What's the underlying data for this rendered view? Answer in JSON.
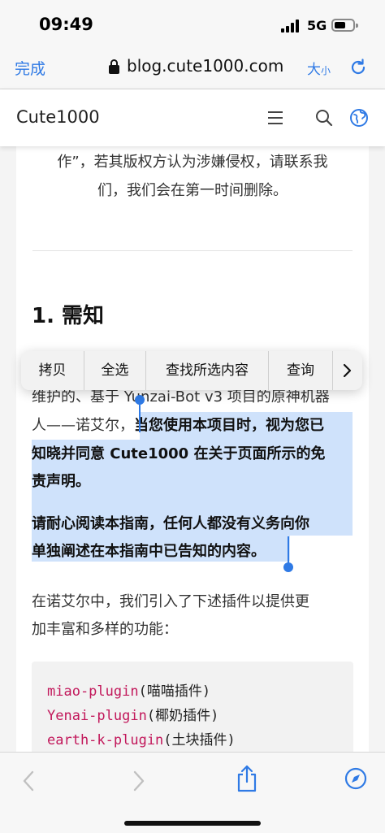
{
  "status": {
    "time": "09:49",
    "network": "5G"
  },
  "browser": {
    "done_label": "完成",
    "url": "blog.cute1000.com",
    "text_size_big": "大",
    "text_size_small": "小"
  },
  "site": {
    "brand": "Cute1000"
  },
  "article": {
    "intro_line1": "作”，若其版权方认为涉嫌侵权，请联系我",
    "intro_line2": "们，我们会在第一时间删除。",
    "heading": "1. 需知",
    "p1_line1": "维护的、基于 Yunzai-Bot v3 项目的原神机器",
    "p1_line2_plain": "人——诺艾尔，",
    "p1_line2_bold": "当您使用本项目时，视为您已",
    "p1_line3": "知晓并同意 Cute1000 在关于页面所示的免",
    "p1_line4": "责声明。",
    "p2_line1": "请耐心阅读本指南，任何人都没有义务向你",
    "p2_line2": "单独阐述在本指南中已告知的内容。",
    "p3_line1": "在诺艾尔中，我们引入了下述插件以提供更",
    "p3_line2": "加丰富和多样的功能：",
    "plugins": [
      {
        "name": "miao-plugin",
        "desc": "(喵喵插件)"
      },
      {
        "name": "Yenai-plugin",
        "desc": "(椰奶插件)"
      },
      {
        "name": "earth-k-plugin",
        "desc": "(土块插件)"
      }
    ]
  },
  "context_menu": {
    "items": [
      "拷贝",
      "全选",
      "查找所选内容",
      "查询"
    ]
  },
  "colors": {
    "accent": "#2f7ae5",
    "selection": "#cfe2fb",
    "code_keyword": "#c2185b"
  }
}
